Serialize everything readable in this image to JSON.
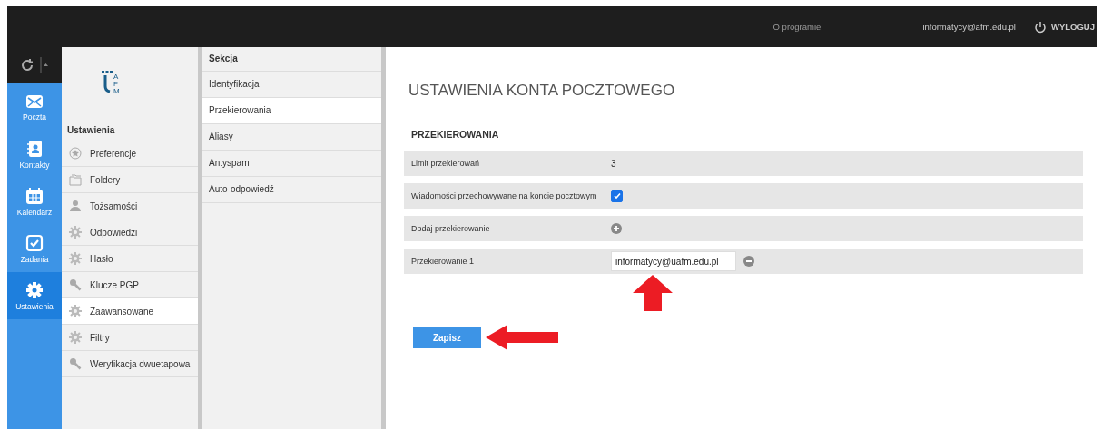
{
  "top_bar": {
    "about": "O programie",
    "user": "informatycy@afm.edu.pl",
    "logout": "WYLOGUJ"
  },
  "rail": [
    {
      "label": "Poczta",
      "kind": "mail",
      "selected": false
    },
    {
      "label": "Kontakty",
      "kind": "contacts",
      "selected": false
    },
    {
      "label": "Kalendarz",
      "kind": "calendar",
      "selected": false
    },
    {
      "label": "Zadania",
      "kind": "tasks",
      "selected": false
    },
    {
      "label": "Ustawienia",
      "kind": "settings",
      "selected": true
    }
  ],
  "logo": {
    "letters": [
      "A",
      "F",
      "M"
    ]
  },
  "settings": {
    "heading": "Ustawienia",
    "items": [
      {
        "label": "Preferencje",
        "kind": "star",
        "selected": false
      },
      {
        "label": "Foldery",
        "kind": "folder",
        "selected": false
      },
      {
        "label": "Tożsamości",
        "kind": "person",
        "selected": false
      },
      {
        "label": "Odpowiedzi",
        "kind": "gear",
        "selected": false
      },
      {
        "label": "Hasło",
        "kind": "gear",
        "selected": false
      },
      {
        "label": "Klucze PGP",
        "kind": "key",
        "selected": false
      },
      {
        "label": "Zaawansowane",
        "kind": "gear",
        "selected": true
      },
      {
        "label": "Filtry",
        "kind": "gear",
        "selected": false
      },
      {
        "label": "Weryfikacja dwuetapowa",
        "kind": "key",
        "selected": false
      }
    ]
  },
  "sections": {
    "heading": "Sekcja",
    "items": [
      {
        "label": "Identyfikacja",
        "selected": false
      },
      {
        "label": "Przekierowania",
        "selected": true
      },
      {
        "label": "Aliasy",
        "selected": false
      },
      {
        "label": "Antyspam",
        "selected": false
      },
      {
        "label": "Auto-odpowiedź",
        "selected": false
      }
    ]
  },
  "content": {
    "title": "USTAWIENIA KONTA POCZTOWEGO",
    "section_title": "PRZEKIEROWANIA",
    "rows": [
      {
        "kind": "text",
        "label": "Limit przekierowań",
        "value": "3"
      },
      {
        "kind": "checkbox",
        "label": "Wiadomości przechowywane na koncie pocztowym",
        "checked": true
      },
      {
        "kind": "add",
        "label": "Dodaj przekierowanie"
      },
      {
        "kind": "field",
        "label": "Przekierowanie 1",
        "value": "informatycy@uafm.edu.pl"
      }
    ],
    "save": "Zapisz"
  }
}
